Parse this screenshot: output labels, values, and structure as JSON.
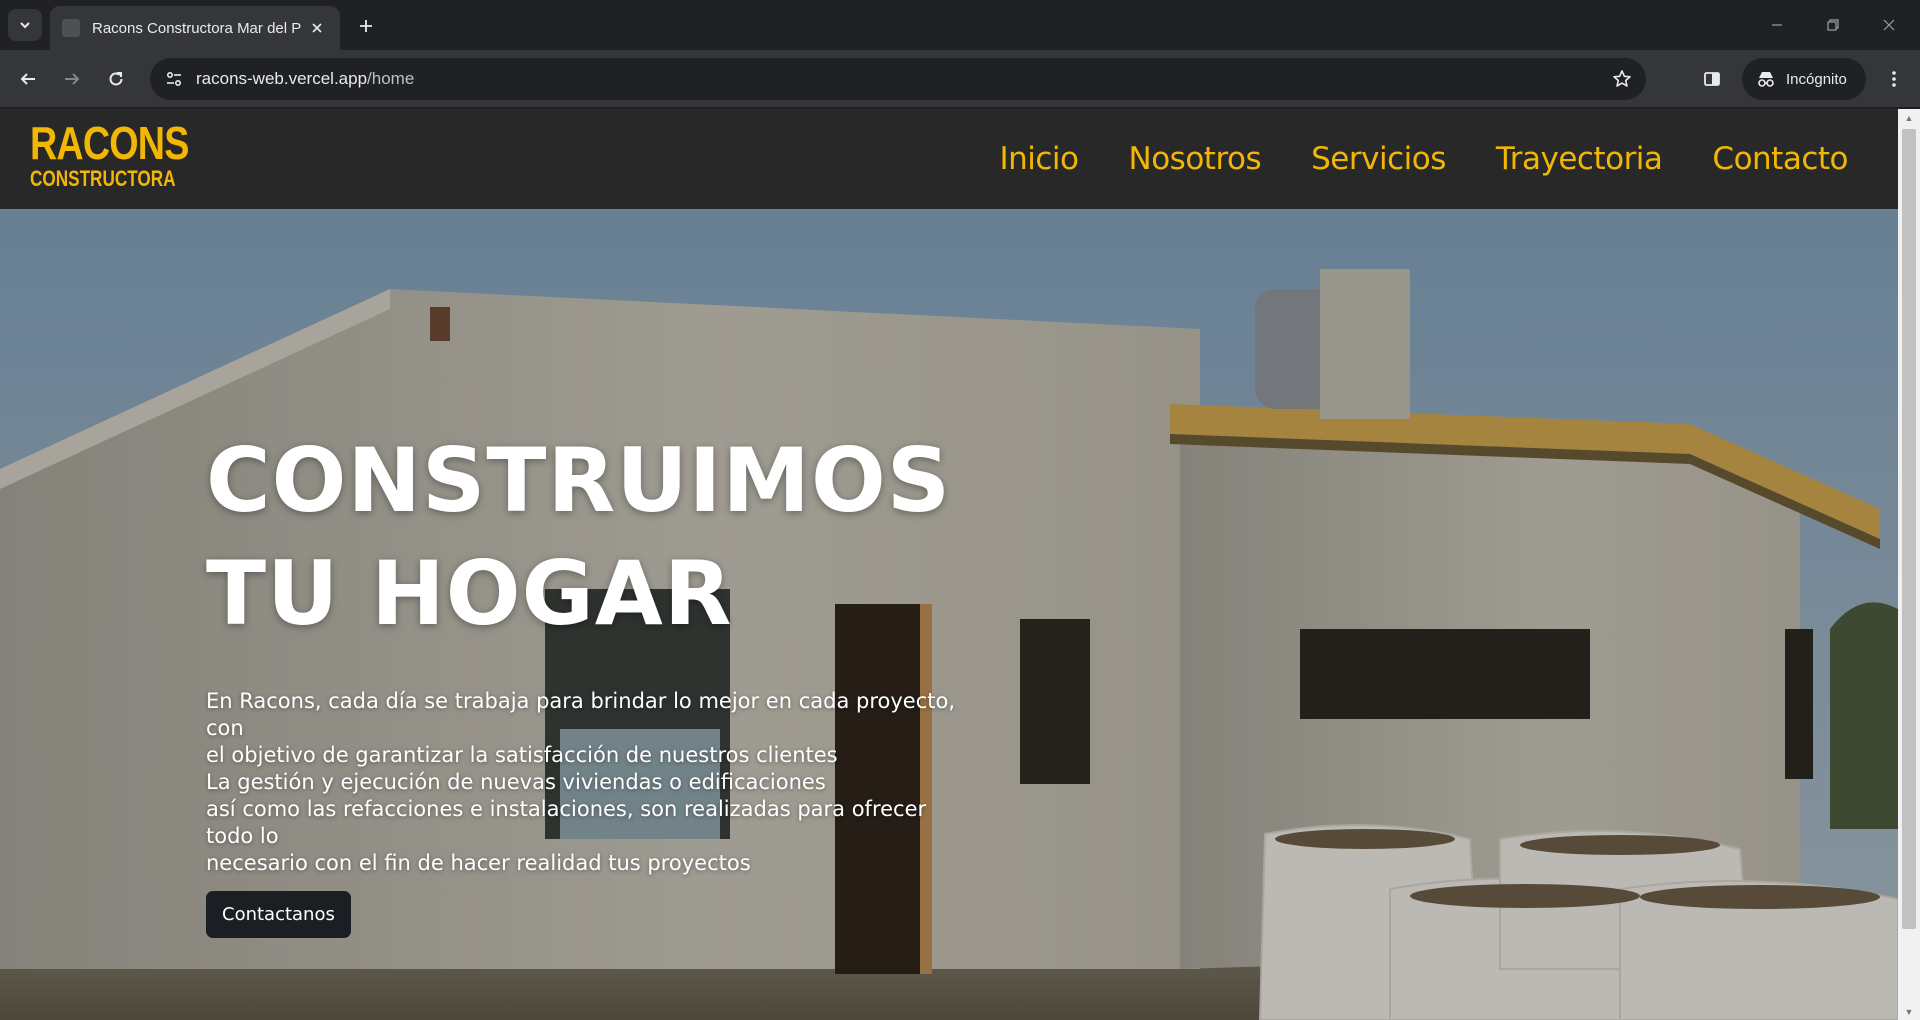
{
  "browser": {
    "tab_title": "Racons Constructora Mar del Pl",
    "url_host": "racons-web.vercel.app",
    "url_path": "/home",
    "incognito_label": "Incógnito"
  },
  "site": {
    "logo": {
      "line1": "RACONS",
      "line2": "CONSTRUCTORA"
    },
    "nav": [
      "Inicio",
      "Nosotros",
      "Servicios",
      "Trayectoria",
      "Contacto"
    ],
    "accent_color": "#f2b705",
    "header_bg": "#282828"
  },
  "hero": {
    "title_line1": "CONSTRUIMOS",
    "title_line2": "TU HOGAR",
    "paragraph": [
      "En Racons, cada día se trabaja para brindar lo mejor en cada proyecto, con",
      "el objetivo de garantizar la satisfacción de nuestros clientes",
      "La gestión y ejecución de nuevas viviendas o edificaciones",
      "así como las refacciones e instalaciones, son realizadas para ofrecer todo lo",
      "necesario con el fin de hacer realidad tus proyectos"
    ],
    "cta_label": "Contactanos"
  }
}
